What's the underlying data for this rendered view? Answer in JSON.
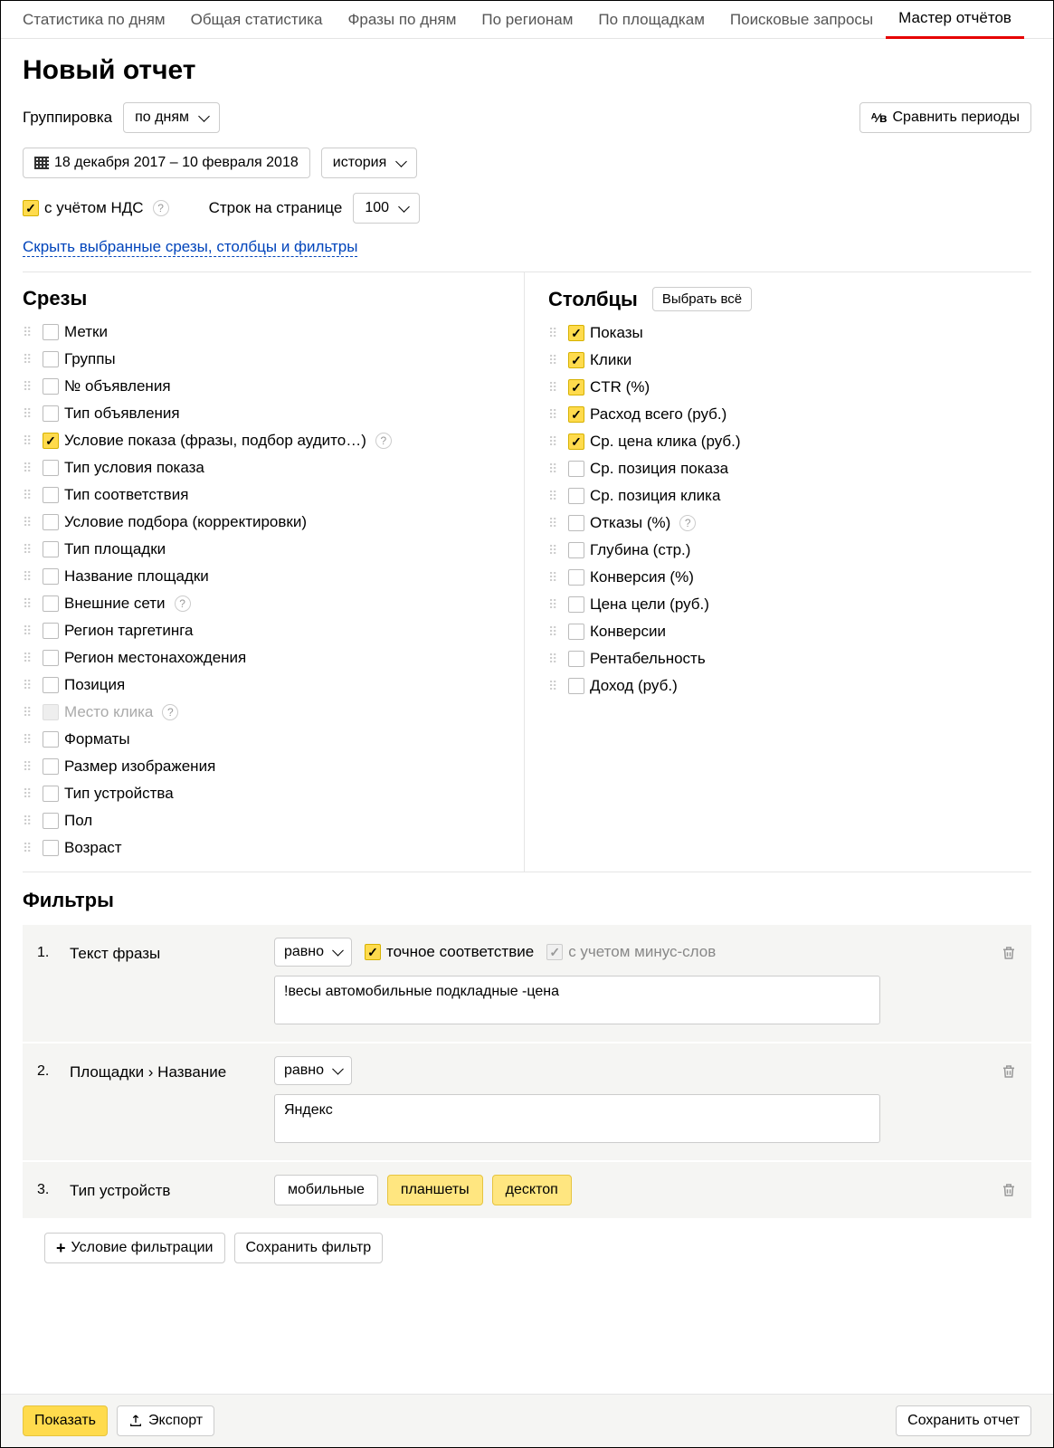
{
  "tabs": {
    "items": [
      "Статистика по дням",
      "Общая статистика",
      "Фразы по дням",
      "По регионам",
      "По площадкам",
      "Поисковые запросы",
      "Мастер отчётов"
    ],
    "active": "Мастер отчётов"
  },
  "title": "Новый отчет",
  "grouping_label": "Группировка",
  "grouping_value": "по дням",
  "compare_btn": "Сравнить периоды",
  "date_range": "18 декабря 2017 – 10 февраля 2018",
  "history_btn": "история",
  "vat_label": "с учётом НДС",
  "rows_label": "Строк на странице",
  "rows_value": "100",
  "hide_link": "Скрыть выбранные срезы, столбцы и фильтры",
  "slices_title": "Срезы",
  "columns_title": "Столбцы",
  "select_all_btn": "Выбрать всё",
  "slices": [
    {
      "label": "Метки",
      "checked": false
    },
    {
      "label": "Группы",
      "checked": false
    },
    {
      "label": "№ объявления",
      "checked": false
    },
    {
      "label": "Тип объявления",
      "checked": false
    },
    {
      "label": "Условие показа (фразы, подбор аудито…)",
      "checked": true,
      "help": true
    },
    {
      "label": "Тип условия показа",
      "checked": false
    },
    {
      "label": "Тип соответствия",
      "checked": false
    },
    {
      "label": "Условие подбора (корректировки)",
      "checked": false
    },
    {
      "label": "Тип площадки",
      "checked": false
    },
    {
      "label": "Название площадки",
      "checked": false
    },
    {
      "label": "Внешние сети",
      "checked": false,
      "help": true
    },
    {
      "label": "Регион таргетинга",
      "checked": false
    },
    {
      "label": "Регион местонахождения",
      "checked": false
    },
    {
      "label": "Позиция",
      "checked": false
    },
    {
      "label": "Место клика",
      "checked": false,
      "disabled": true,
      "help": true
    },
    {
      "label": "Форматы",
      "checked": false
    },
    {
      "label": "Размер изображения",
      "checked": false
    },
    {
      "label": "Тип устройства",
      "checked": false
    },
    {
      "label": "Пол",
      "checked": false
    },
    {
      "label": "Возраст",
      "checked": false
    }
  ],
  "columns": [
    {
      "label": "Показы",
      "checked": true
    },
    {
      "label": "Клики",
      "checked": true
    },
    {
      "label": "CTR (%)",
      "checked": true
    },
    {
      "label": "Расход всего (руб.)",
      "checked": true
    },
    {
      "label": "Ср. цена клика (руб.)",
      "checked": true
    },
    {
      "label": "Ср. позиция показа",
      "checked": false
    },
    {
      "label": "Ср. позиция клика",
      "checked": false
    },
    {
      "label": "Отказы (%)",
      "checked": false,
      "help": true
    },
    {
      "label": "Глубина (стр.)",
      "checked": false
    },
    {
      "label": "Конверсия (%)",
      "checked": false
    },
    {
      "label": "Цена цели (руб.)",
      "checked": false
    },
    {
      "label": "Конверсии",
      "checked": false
    },
    {
      "label": "Рентабельность",
      "checked": false
    },
    {
      "label": "Доход (руб.)",
      "checked": false
    }
  ],
  "filters_title": "Фильтры",
  "filters": [
    {
      "num": "1.",
      "name": "Текст фразы",
      "op": "равно",
      "exact_label": "точное соответствие",
      "minus_label": "с учетом минус-слов",
      "value": "!весы автомобильные подкладные -цена"
    },
    {
      "num": "2.",
      "name": "Площадки › Название",
      "op": "равно",
      "value": "Яндекс"
    },
    {
      "num": "3.",
      "name": "Тип устройств",
      "toggles": [
        {
          "label": "мобильные",
          "on": false
        },
        {
          "label": "планшеты",
          "on": true
        },
        {
          "label": "десктоп",
          "on": true
        }
      ]
    }
  ],
  "add_filter_btn": "Условие фильтрации",
  "save_filter_btn": "Сохранить фильтр",
  "show_btn": "Показать",
  "export_btn": "Экспорт",
  "save_report_btn": "Сохранить отчет"
}
